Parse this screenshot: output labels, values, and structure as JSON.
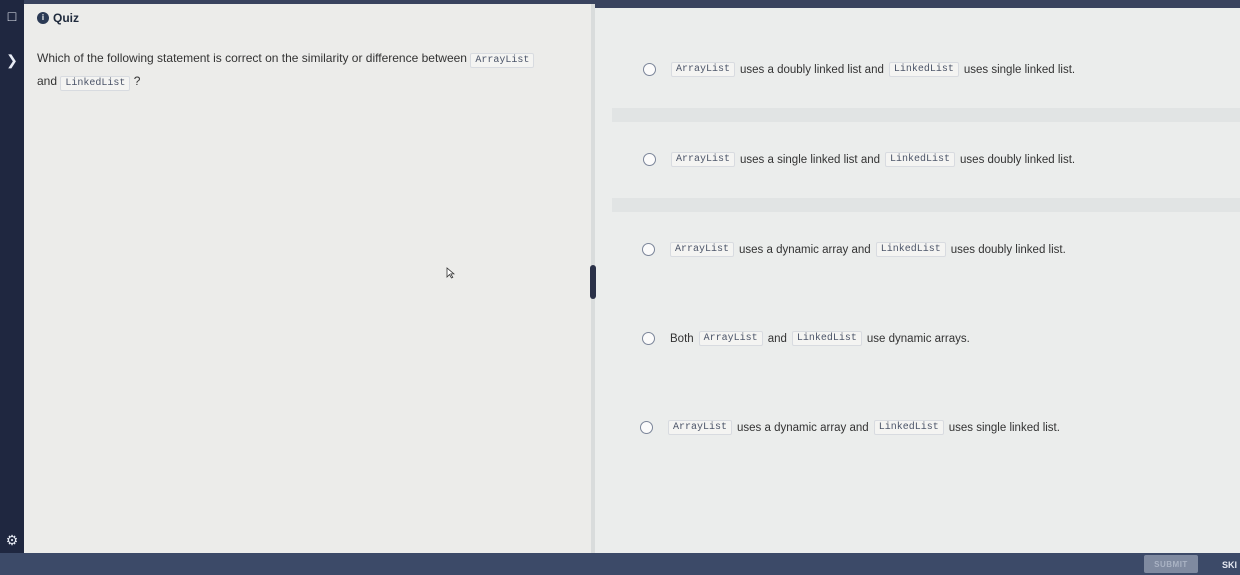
{
  "quiz": {
    "badge": "i",
    "title": "Quiz"
  },
  "question": {
    "prefix": "Which of the following statement is correct on the similarity or difference between",
    "code1": "ArrayList",
    "middle": "and",
    "code2": "LinkedList",
    "suffix": "?"
  },
  "options": [
    {
      "parts": [
        {
          "code": "ArrayList"
        },
        {
          "text": "uses a doubly linked list and"
        },
        {
          "code": "LinkedList"
        },
        {
          "text": "uses single linked list."
        }
      ]
    },
    {
      "parts": [
        {
          "code": "ArrayList"
        },
        {
          "text": "uses a single linked list and"
        },
        {
          "code": "LinkedList"
        },
        {
          "text": "uses doubly linked list."
        }
      ]
    },
    {
      "parts": [
        {
          "code": "ArrayList"
        },
        {
          "text": "uses a dynamic array and"
        },
        {
          "code": "LinkedList"
        },
        {
          "text": "uses doubly linked list."
        }
      ]
    },
    {
      "parts": [
        {
          "text": "Both"
        },
        {
          "code": "ArrayList"
        },
        {
          "text": "and"
        },
        {
          "code": "LinkedList"
        },
        {
          "text": "use dynamic arrays."
        }
      ]
    },
    {
      "parts": [
        {
          "code": "ArrayList"
        },
        {
          "text": "uses a dynamic array and"
        },
        {
          "code": "LinkedList"
        },
        {
          "text": "uses single linked list."
        }
      ]
    }
  ],
  "footer": {
    "submit_label": "SUBMIT",
    "skip_label": "SKI"
  },
  "rail_icons": [
    "document-icon",
    "back-icon",
    "settings-icon"
  ]
}
